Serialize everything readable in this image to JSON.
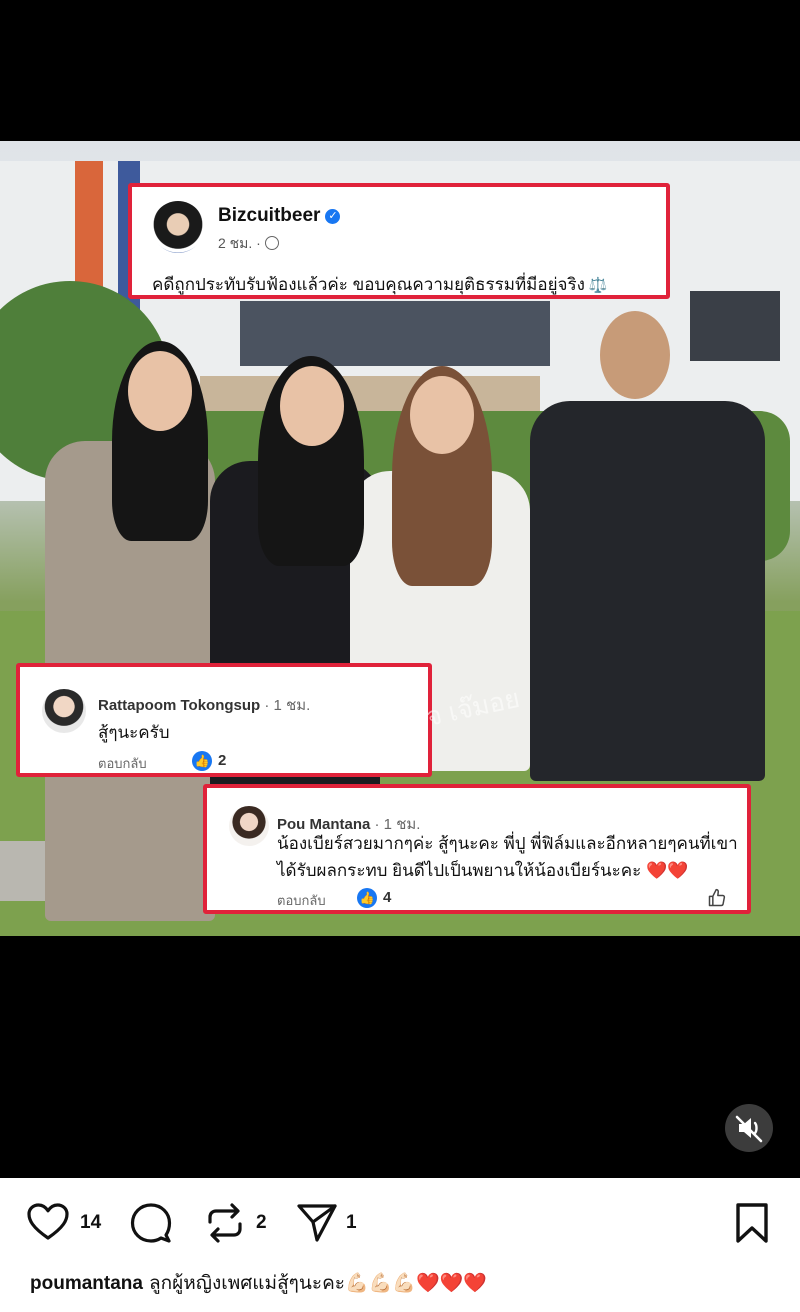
{
  "post": {
    "name": "Bizcuitbeer",
    "meta": "2 ชม. ·",
    "text": "คดีถูกประทับรับฟ้องแล้วค่ะ ขอบคุณความยุติธรรมที่มีอยู่จริง",
    "scales_icon": "⚖️"
  },
  "comments": [
    {
      "name": "Rattapoom Tokongsup",
      "time": "· 1 ชม.",
      "text": "สู้ๆนะครับ",
      "reply": "ตอบกลับ",
      "likes": "2"
    },
    {
      "name": "Pou Mantana",
      "time": "· 1 ชม.",
      "text_line1": "น้องเบียร์สวยมากๆค่ะ สู้ๆนะคะ พี่ปู พี่ฟิล์มและอีกหลายๆคนที่เขา",
      "text_line2": "ได้รับผลกระทบ ยินดีไปเป็นพยานให้น้องเบียร์นะคะ",
      "text_hearts": "❤️❤️",
      "reply": "ตอบกลับ",
      "likes": "4"
    }
  ],
  "watermark": "เพจ เจ๊มอย",
  "actions": {
    "like_count": "14",
    "repost_count": "2",
    "share_count": "1"
  },
  "caption": {
    "username": "poumantana",
    "text": "ลูกผู้หญิงเพศแม่สู้ๆนะคะ",
    "muscles": "💪🏻💪🏻💪🏻",
    "hearts": "❤️❤️❤️"
  },
  "icons": {
    "like": "heart-icon",
    "comment": "comment-icon",
    "repost": "repost-icon",
    "share": "send-icon",
    "save": "bookmark-icon",
    "mute": "muted-speaker-icon"
  },
  "colors": {
    "highlight_border": "#e0223a",
    "facebook_blue": "#1877f2"
  }
}
